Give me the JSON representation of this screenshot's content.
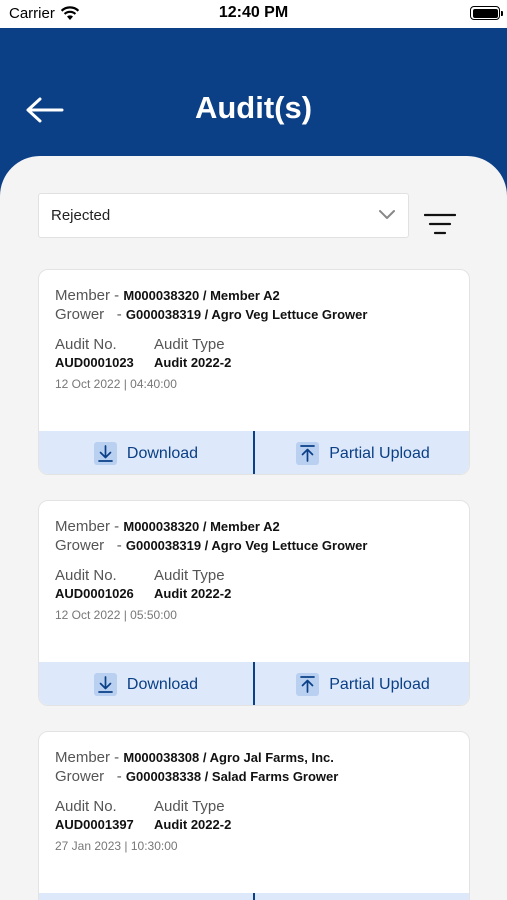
{
  "status_bar": {
    "carrier": "Carrier",
    "time": "12:40 PM"
  },
  "header": {
    "title": "Audit(s)"
  },
  "filter": {
    "selected": "Rejected"
  },
  "labels": {
    "member": "Member -",
    "grower": "Grower",
    "grower_dash": "-",
    "audit_no": "Audit No.",
    "audit_type": "Audit Type",
    "download": "Download",
    "partial_upload": "Partial Upload"
  },
  "audits": [
    {
      "member": "M000038320 / Member A2",
      "grower": "G000038319 / Agro Veg Lettuce Grower",
      "audit_no": "AUD0001023",
      "audit_type": "Audit 2022-2",
      "date": "12 Oct 2022 | 04:40:00"
    },
    {
      "member": "M000038320 / Member A2",
      "grower": "G000038319 / Agro Veg Lettuce Grower",
      "audit_no": "AUD0001026",
      "audit_type": "Audit 2022-2",
      "date": "12 Oct 2022 | 05:50:00"
    },
    {
      "member": "M000038308 / Agro Jal Farms, Inc.",
      "grower": "G000038338 / Salad Farms Grower",
      "audit_no": "AUD0001397",
      "audit_type": "Audit 2022-2",
      "date": "27 Jan 2023 | 10:30:00"
    }
  ]
}
